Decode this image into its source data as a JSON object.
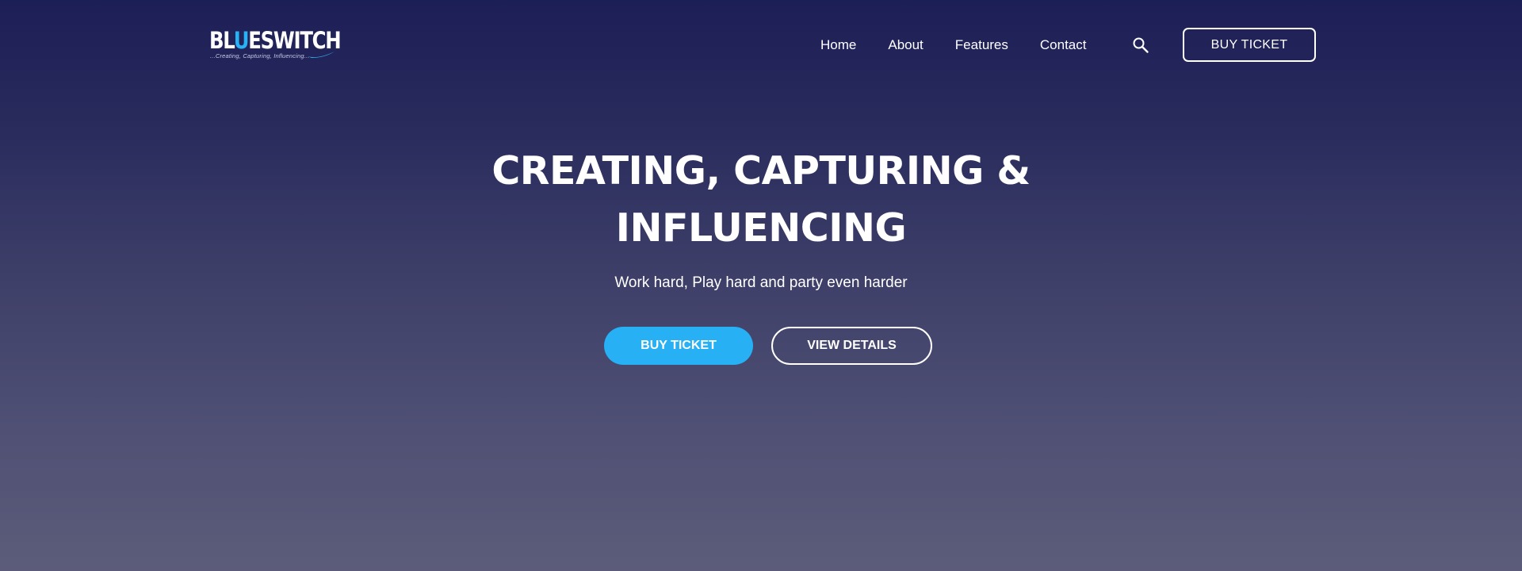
{
  "brand": {
    "logo_prefix": "BL",
    "logo_accent": "U",
    "logo_suffix": "ESWITCH",
    "tagline": "...Creating, Capturing, Influencing...",
    "accent_color": "#29b1f5"
  },
  "nav": {
    "links": [
      "Home",
      "About",
      "Features",
      "Contact"
    ],
    "search_icon": "search-icon",
    "ticket_label": "BUY TICKET"
  },
  "hero": {
    "title_line1": "CREATING, CAPTURING &",
    "title_line2": "INFLUENCING",
    "subtitle": "Work hard, Play hard and party even harder",
    "primary_label": "BUY TICKET",
    "primary_color": "#27b0f4",
    "secondary_label": "VIEW DETAILS"
  },
  "theme": {
    "background_top": "#1c1e56",
    "background_bottom": "#5c5c7a"
  }
}
